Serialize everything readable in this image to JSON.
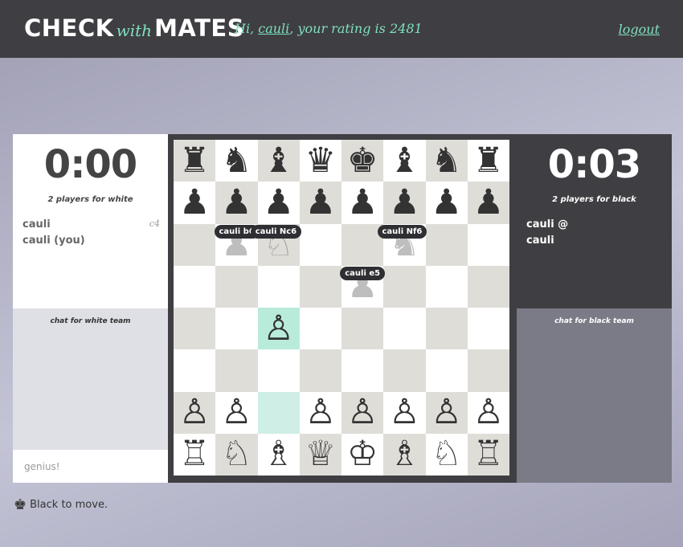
{
  "header": {
    "logo_left": "CHECK",
    "logo_mid": "with",
    "logo_right": "MATES",
    "greeting_prefix": "Hi, ",
    "username": "cauli",
    "greeting_suffix": ", your rating is 2481",
    "logout_label": "logout"
  },
  "white_panel": {
    "clock": "0:00",
    "team_count": "2 players for white",
    "players": [
      "cauli",
      "cauli (you)"
    ],
    "last_move": "c4"
  },
  "black_panel": {
    "clock": "0:03",
    "team_count": "2 players for black",
    "players": [
      "cauli @",
      "cauli"
    ]
  },
  "chat_white": {
    "title": "chat for white team",
    "input_placeholder": "genius!"
  },
  "chat_black": {
    "title": "chat for black team"
  },
  "status": {
    "icon": "king-icon",
    "text": "Black to move."
  },
  "colors": {
    "accent": "#7fe0bf",
    "topbar": "#3f3f43",
    "highlight_from": "#cfeee5",
    "highlight_to": "#b9ebdb"
  },
  "board": {
    "highlights": {
      "from": "c2",
      "to": "c4"
    },
    "pieces": [
      {
        "square": "a8",
        "color": "black",
        "type": "rook",
        "glyph": "♜"
      },
      {
        "square": "b8",
        "color": "black",
        "type": "knight",
        "glyph": "♞"
      },
      {
        "square": "c8",
        "color": "black",
        "type": "bishop",
        "glyph": "♝"
      },
      {
        "square": "d8",
        "color": "black",
        "type": "queen",
        "glyph": "♛"
      },
      {
        "square": "e8",
        "color": "black",
        "type": "king",
        "glyph": "♚"
      },
      {
        "square": "f8",
        "color": "black",
        "type": "bishop",
        "glyph": "♝"
      },
      {
        "square": "g8",
        "color": "black",
        "type": "knight",
        "glyph": "♞"
      },
      {
        "square": "h8",
        "color": "black",
        "type": "rook",
        "glyph": "♜"
      },
      {
        "square": "a7",
        "color": "black",
        "type": "pawn",
        "glyph": "♟"
      },
      {
        "square": "b7",
        "color": "black",
        "type": "pawn",
        "glyph": "♟"
      },
      {
        "square": "c7",
        "color": "black",
        "type": "pawn",
        "glyph": "♟"
      },
      {
        "square": "d7",
        "color": "black",
        "type": "pawn",
        "glyph": "♟"
      },
      {
        "square": "e7",
        "color": "black",
        "type": "pawn",
        "glyph": "♟"
      },
      {
        "square": "f7",
        "color": "black",
        "type": "pawn",
        "glyph": "♟"
      },
      {
        "square": "g7",
        "color": "black",
        "type": "pawn",
        "glyph": "♟"
      },
      {
        "square": "h7",
        "color": "black",
        "type": "pawn",
        "glyph": "♟"
      },
      {
        "square": "c4",
        "color": "white",
        "type": "pawn",
        "glyph": "♙"
      },
      {
        "square": "a2",
        "color": "white",
        "type": "pawn",
        "glyph": "♙"
      },
      {
        "square": "b2",
        "color": "white",
        "type": "pawn",
        "glyph": "♙"
      },
      {
        "square": "d2",
        "color": "white",
        "type": "pawn",
        "glyph": "♙"
      },
      {
        "square": "e2",
        "color": "white",
        "type": "pawn",
        "glyph": "♙"
      },
      {
        "square": "f2",
        "color": "white",
        "type": "pawn",
        "glyph": "♙"
      },
      {
        "square": "g2",
        "color": "white",
        "type": "pawn",
        "glyph": "♙"
      },
      {
        "square": "h2",
        "color": "white",
        "type": "pawn",
        "glyph": "♙"
      },
      {
        "square": "a1",
        "color": "white",
        "type": "rook",
        "glyph": "♖"
      },
      {
        "square": "b1",
        "color": "white",
        "type": "knight",
        "glyph": "♘"
      },
      {
        "square": "c1",
        "color": "white",
        "type": "bishop",
        "glyph": "♗"
      },
      {
        "square": "d1",
        "color": "white",
        "type": "queen",
        "glyph": "♕"
      },
      {
        "square": "e1",
        "color": "white",
        "type": "king",
        "glyph": "♔"
      },
      {
        "square": "f1",
        "color": "white",
        "type": "bishop",
        "glyph": "♗"
      },
      {
        "square": "g1",
        "color": "white",
        "type": "knight",
        "glyph": "♘"
      },
      {
        "square": "h1",
        "color": "white",
        "type": "rook",
        "glyph": "♖"
      }
    ],
    "ghosts": [
      {
        "square": "b6",
        "glyph": "♟"
      },
      {
        "square": "c6",
        "glyph": "♘"
      },
      {
        "square": "f6",
        "glyph": "♞"
      },
      {
        "square": "e5",
        "glyph": "♟"
      }
    ],
    "suggestions": [
      {
        "square": "b6",
        "label": "cauli b6"
      },
      {
        "square": "c6",
        "label": "cauli Nc6"
      },
      {
        "square": "f6",
        "label": "cauli Nf6"
      },
      {
        "square": "e5",
        "label": "cauli e5"
      }
    ]
  }
}
